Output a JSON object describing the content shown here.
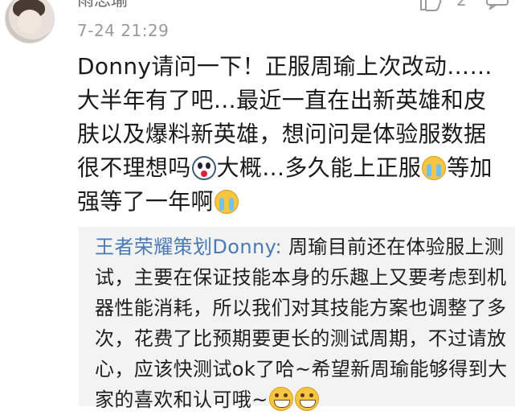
{
  "comment": {
    "author": "雨思瑜",
    "timestamp": "7-24 21:29",
    "like_count": "2",
    "text_part1": "Donny请问一下！正服周瑜上次改动……大半年有了吧…最近一直在出新英雄和皮肤以及爆料新英雄，想问问是体验服数据很不理想吗",
    "text_part2": "大概…多久能上正服",
    "text_part3": "等加强等了一年啊",
    "emoji_1": "shocked-emoji",
    "emoji_2": "crying-emoji",
    "emoji_3": "crying-emoji"
  },
  "reply": {
    "author": "王者荣耀策划Donny:",
    "text": " 周瑜目前还在体验服上测试，主要在保证技能本身的乐趣上又要考虑到机器性能消耗，所以我们对其技能方案也调整了多次，花费了比预期要更长的测试周期，不过请放心，应该快测试ok了哈~希望新周瑜能够得到大家的喜欢和认可哦~",
    "emoji_1": "grinning-emoji",
    "emoji_2": "grinning-emoji"
  },
  "colors": {
    "reply_author": "#4a7ab5",
    "reply_background": "#f3f3f3",
    "meta_text": "#9a9a9a"
  }
}
